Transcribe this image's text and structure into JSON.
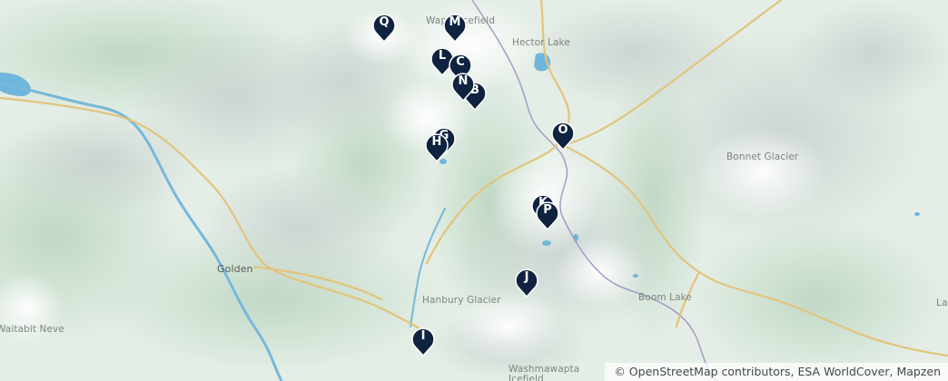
{
  "map": {
    "place_labels": [
      {
        "id": "wapta",
        "text": "Wapta Icefield"
      },
      {
        "id": "hector",
        "text": "Hector Lake"
      },
      {
        "id": "bonnet",
        "text": "Bonnet Glacier"
      },
      {
        "id": "golden",
        "text": "Golden"
      },
      {
        "id": "hanbury",
        "text": "Hanbury Glacier"
      },
      {
        "id": "boom",
        "text": "Boom Lake"
      },
      {
        "id": "washmawapta",
        "text": "Washmawapta\nIcefield"
      },
      {
        "id": "waitneve",
        "text": "Waitabit Neve"
      },
      {
        "id": "la",
        "text": "La"
      }
    ],
    "markers": [
      "M",
      "Q",
      "L",
      "C",
      "N",
      "B",
      "G",
      "H",
      "O",
      "K",
      "P",
      "J",
      "I"
    ],
    "colors": {
      "marker_fill": "#0f2340",
      "marker_text": "#ffffff",
      "water": "#6fb6dd",
      "road": "#e2c47c",
      "boundary": "#a79ac3",
      "land": "#e4eee6"
    }
  },
  "attribution": "© OpenStreetMap contributors, ESA WorldCover, Mapzen"
}
